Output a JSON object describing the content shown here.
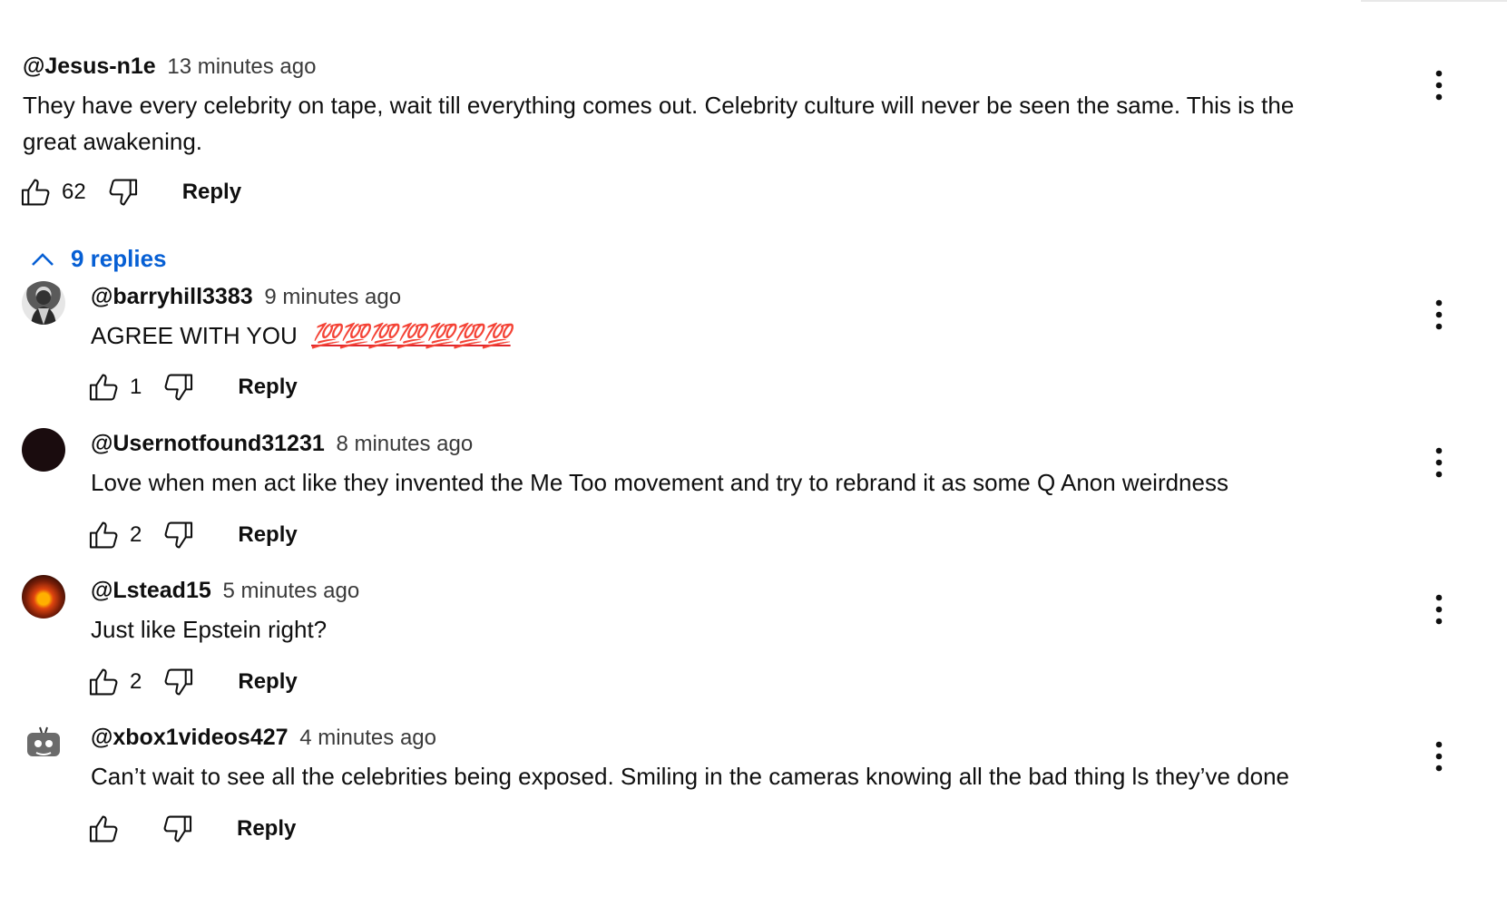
{
  "top_comment": {
    "author": "@Jesus-n1e",
    "time": "13 minutes ago",
    "text": "They have every celebrity on tape, wait till everything comes out. Celebrity culture will never be seen the same. This is the great awakening.",
    "likes": "62",
    "reply_label": "Reply"
  },
  "replies_toggle": {
    "label": "9 replies"
  },
  "replies": [
    {
      "author": "@barryhill3383",
      "time": "9 minutes ago",
      "text": "AGREE WITH YOU",
      "emoji": "💯💯💯💯💯💯💯",
      "likes": "1",
      "reply_label": "Reply"
    },
    {
      "author": "@Usernotfound31231",
      "time": "8 minutes ago",
      "text": "Love when men act like they invented the Me Too movement and try to rebrand it as some Q Anon weirdness",
      "likes": "2",
      "reply_label": "Reply"
    },
    {
      "author": "@Lstead15",
      "time": "5 minutes ago",
      "text": "Just like Epstein right?",
      "likes": "2",
      "reply_label": "Reply"
    },
    {
      "author": "@xbox1videos427",
      "time": "4 minutes ago",
      "text": "Can’t wait to see all the celebrities being exposed. Smiling in the cameras knowing all the bad thing ls they’ve done",
      "likes": "",
      "reply_label": "Reply"
    }
  ],
  "icons": {
    "like": "thumbs-up-icon",
    "dislike": "thumbs-down-icon",
    "menu": "more-vert-icon",
    "toggle": "chevron-up-icon"
  },
  "colors": {
    "link_blue": "#065fd4",
    "emoji_red": "#e0262b"
  }
}
